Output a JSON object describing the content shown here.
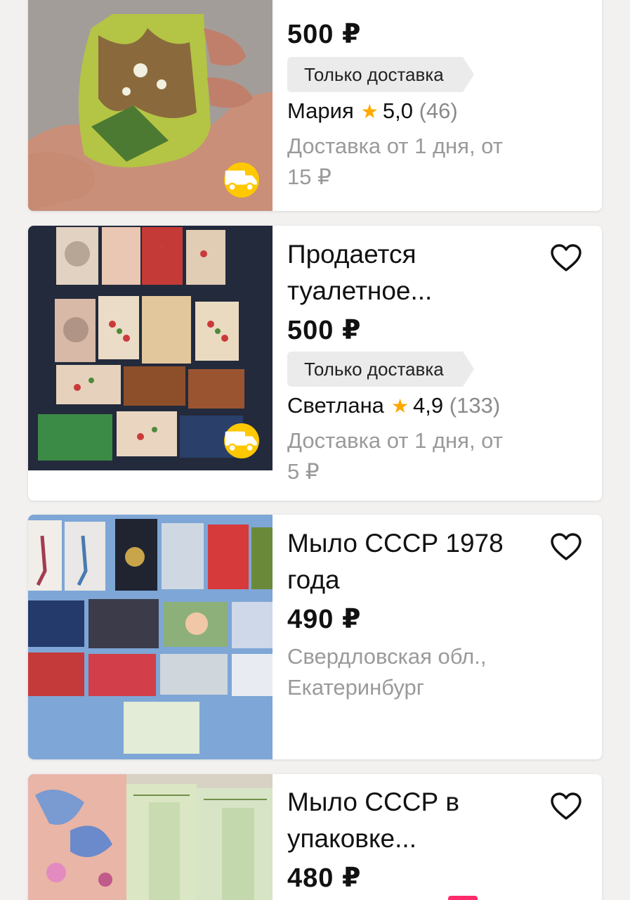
{
  "listings": [
    {
      "price": "500 ₽",
      "badge": "Только доставка",
      "seller": "Мария",
      "rating": "5,0",
      "reviews": "(46)",
      "delivery_line1": "Доставка от 1 дня, от",
      "delivery_line2": "15 ₽"
    },
    {
      "title_line1": "Продается",
      "title_line2": "туалетное...",
      "price": "500 ₽",
      "badge": "Только доставка",
      "seller": "Светлана",
      "rating": "4,9",
      "reviews": "(133)",
      "delivery_line1": "Доставка от 1 дня, от",
      "delivery_line2": "5 ₽"
    },
    {
      "title_line1": "Мыло СССР 1978",
      "title_line2": "года",
      "price": "490 ₽",
      "location_line1": "Свердловская обл.,",
      "location_line2": "Екатеринбург"
    },
    {
      "title_line1": "Мыло СССР в",
      "title_line2": "упаковке...",
      "price": "480 ₽"
    }
  ],
  "icons": {
    "favorite": "heart-outline-icon",
    "delivery": "truck-icon",
    "rating": "star-icon"
  },
  "colors": {
    "accent_yellow": "#ffc800",
    "star": "#ffa800",
    "badge_bg": "#ebebeb",
    "muted_text": "#9a9a9a"
  }
}
